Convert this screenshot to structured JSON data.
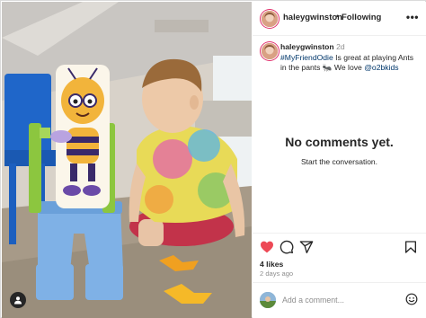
{
  "header": {
    "username": "haleygwinston",
    "separator": "•",
    "follow_state": "Following",
    "more_label": "•••"
  },
  "caption": {
    "username": "haleygwinston",
    "time": "2d",
    "hashtag": "#MyFriendOdie",
    "text_1": " Is great at playing Ants in the pants 🐜 We love ",
    "mention": "@o2bkids"
  },
  "comments": {
    "empty_title": "No comments yet.",
    "empty_subtitle": "Start the conversation."
  },
  "actions": {
    "like_icon": "heart-filled-icon",
    "comment_icon": "comment-icon",
    "share_icon": "send-icon",
    "save_icon": "bookmark-icon",
    "likes": "4 likes",
    "posted_ago": "2 days ago"
  },
  "add_comment": {
    "placeholder": "Add a comment..."
  },
  "colors": {
    "like_red": "#ed4956",
    "link_blue": "#00376b",
    "muted_text": "#8e8e8e",
    "border": "#dbdbdb"
  }
}
